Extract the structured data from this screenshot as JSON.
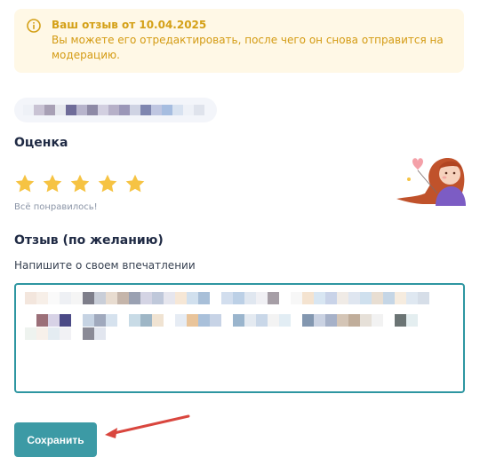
{
  "notice": {
    "title": "Ваш отзыв от 10.04.2025",
    "text": "Вы можете его отредактировать, после чего он снова отправится на модерацию.",
    "icon": "info-icon"
  },
  "product_pill": {
    "icon": "pixelated-product-name"
  },
  "rating": {
    "title": "Оценка",
    "stars_total": 5,
    "stars_selected": 5,
    "caption": "Всё понравилось!",
    "star_color": "#f6c343"
  },
  "review": {
    "title": "Отзыв (по желанию)",
    "label": "Напишите о своем впечатлении",
    "text_icon": "pixelated-review-text"
  },
  "actions": {
    "save_label": "Сохранить"
  },
  "colors": {
    "accent": "#3c9aa5",
    "notice_bg": "#fff8e6",
    "notice_text": "#d4a017",
    "arrow": "#d9463e"
  }
}
